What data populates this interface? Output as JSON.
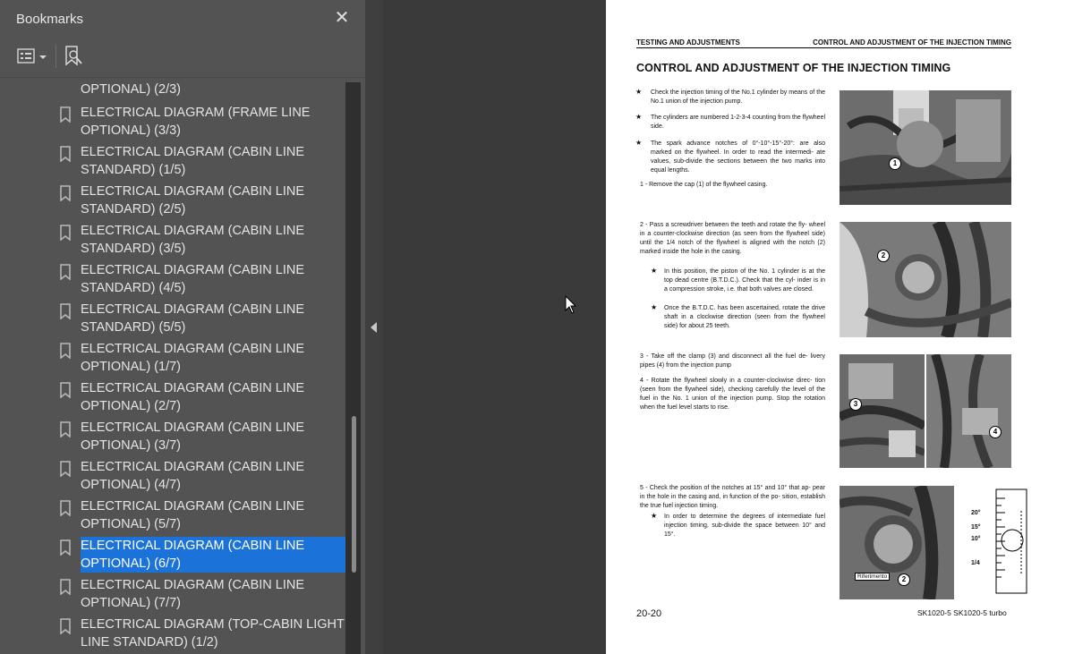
{
  "panel": {
    "title": "Bookmarks",
    "close_icon": "close-icon",
    "options_icon": "bookmark-options-icon",
    "add_icon": "new-bookmark-icon"
  },
  "bookmarks": [
    {
      "label": "OPTIONAL) (2/3)",
      "selected": false,
      "icon": false
    },
    {
      "label": "ELECTRICAL DIAGRAM (FRAME LINE OPTIONAL) (3/3)",
      "selected": false,
      "icon": true
    },
    {
      "label": "ELECTRICAL DIAGRAM (CABIN LINE STANDARD) (1/5)",
      "selected": false,
      "icon": true
    },
    {
      "label": "ELECTRICAL DIAGRAM (CABIN LINE STANDARD) (2/5)",
      "selected": false,
      "icon": true
    },
    {
      "label": "ELECTRICAL DIAGRAM (CABIN LINE STANDARD) (3/5)",
      "selected": false,
      "icon": true
    },
    {
      "label": "ELECTRICAL DIAGRAM (CABIN LINE STANDARD) (4/5)",
      "selected": false,
      "icon": true
    },
    {
      "label": "ELECTRICAL DIAGRAM (CABIN LINE STANDARD) (5/5)",
      "selected": false,
      "icon": true
    },
    {
      "label": "ELECTRICAL DIAGRAM (CABIN LINE OPTIONAL) (1/7)",
      "selected": false,
      "icon": true
    },
    {
      "label": "ELECTRICAL DIAGRAM (CABIN LINE OPTIONAL) (2/7)",
      "selected": false,
      "icon": true
    },
    {
      "label": "ELECTRICAL DIAGRAM (CABIN LINE OPTIONAL) (3/7)",
      "selected": false,
      "icon": true
    },
    {
      "label": "ELECTRICAL DIAGRAM (CABIN LINE OPTIONAL) (4/7)",
      "selected": false,
      "icon": true
    },
    {
      "label": "ELECTRICAL DIAGRAM (CABIN LINE OPTIONAL) (5/7)",
      "selected": false,
      "icon": true
    },
    {
      "label": "ELECTRICAL DIAGRAM (CABIN LINE OPTIONAL) (6/7)",
      "selected": true,
      "icon": true
    },
    {
      "label": "ELECTRICAL DIAGRAM (CABIN LINE OPTIONAL) (7/7)",
      "selected": false,
      "icon": true
    },
    {
      "label": "ELECTRICAL DIAGRAM (TOP-CABIN LIGHT LINE STANDARD) (1/2)",
      "selected": false,
      "icon": true
    }
  ],
  "page": {
    "header_left": "TESTING AND ADJUSTMENTS",
    "header_right": "CONTROL AND ADJUSTMENT OF THE INJECTION TIMING",
    "title": "CONTROL AND ADJUSTMENT OF THE INJECTION TIMING",
    "notes": [
      "Check the injection timing of the No.1 cylinder by means of the No.1 union of the injection pump.",
      "The cylinders are numbered 1-2-3-4 counting from the flywheel side.",
      "The spark advance notches of 0°-10°-15°-20°: are also marked on the flywheel. In order to read the intermedi- ate values, sub-divide the sections between the two marks into equal lengths."
    ],
    "step1": "1 - Remove the cap (1) of the flywheel casing.",
    "step2": "2 - Pass a screwdriver between the teeth and rotate the fly- wheel in a counter-clockwise direction (as seen from the flywheel side) until the 1/4 notch of the flywheel is aligned with the notch (2) marked inside the hole in the casing.",
    "step2_note1": "In this position, the piston of the No. 1 cylinder is at the top dead centre (B.T.D.C.). Check that the cyl- inder is in a compression stroke, i.e. that both valves are closed.",
    "step2_note2": "Once the B.T.D.C. has been ascertained, rotate the drive shaft in a clockwise direction (seen from the flywheel side) for about 25 teeth.",
    "step3": "3 - Take off the clamp (3) and disconnect all the fuel de- livery pipes (4) from the injection pump",
    "step4": "4 - Rotate the flywheel slowly in a counter-clockwise direc- tion (seen from the flywheel side), checking carefully the level of the fuel in the No. 1 union of the injection pump. Stop the rotation when the fuel level starts to rise.",
    "step5": "5 - Check the position of the notches at 15° and 10° that ap- pear in the hole in the casing and, in function of the po- sition, establish the true fuel injection timing.",
    "step5_note": "In order to determine the degrees of intermediate fuel injection timing, sub-divide the space between 10° and 15°.",
    "callouts": [
      "1",
      "2",
      "3",
      "4",
      "2"
    ],
    "riferimento": "Riferimento",
    "scale_labels": [
      "20°",
      "15°",
      "10°",
      "1/4"
    ],
    "footer_left": "20-20",
    "footer_right": "SK1020-5  SK1020-5 turbo",
    "star": "★"
  }
}
